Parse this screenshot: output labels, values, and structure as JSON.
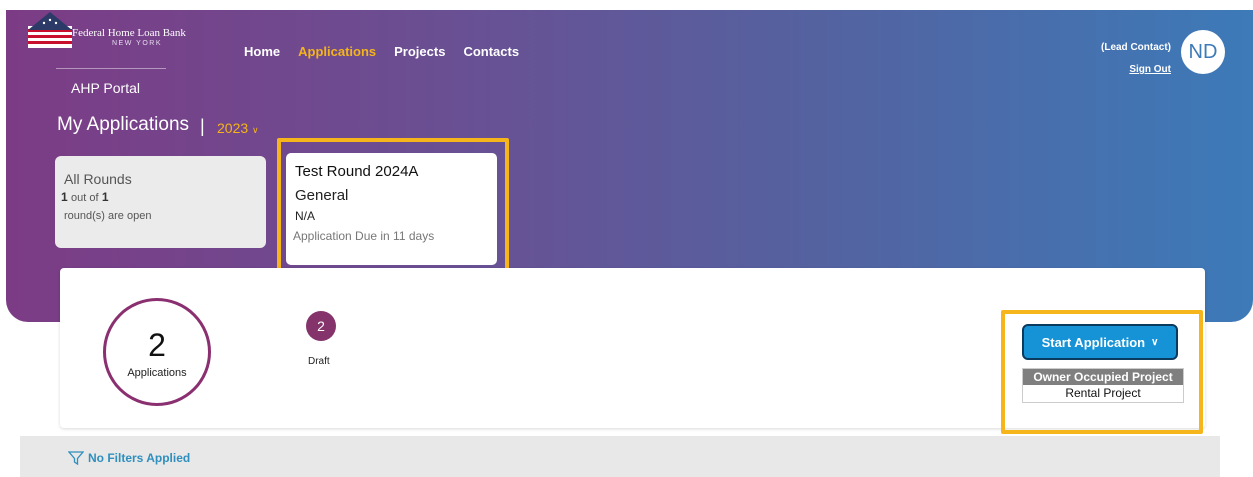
{
  "header": {
    "logo_line1": "Federal Home Loan Bank",
    "logo_line2": "NEW YORK",
    "portal": "AHP Portal",
    "nav": [
      "Home",
      "Applications",
      "Projects",
      "Contacts"
    ],
    "active_nav": "Applications",
    "lead_contact": "(Lead Contact)",
    "sign_out": "Sign Out",
    "avatar_initials": "ND"
  },
  "page": {
    "title": "My Applications",
    "separator": "|",
    "year": "2023"
  },
  "rounds_card": {
    "title": "All Rounds",
    "open_count": "1",
    "out_of": "out of",
    "total": "1",
    "suffix": "round(s) are open"
  },
  "selected_round": {
    "name": "Test Round 2024A",
    "type": "General",
    "detail": "N/A",
    "due": "Application Due in 11 days"
  },
  "summary": {
    "total": "2",
    "total_label": "Applications",
    "draft_count": "2",
    "draft_label": "Draft"
  },
  "actions": {
    "start_label": "Start Application",
    "options": [
      "Owner Occupied Project",
      "Rental Project"
    ],
    "selected_option": "Owner Occupied Project"
  },
  "filters": {
    "label": "No Filters Applied"
  },
  "colors": {
    "accent": "#f4b41a",
    "highlight": "#f7b51c",
    "purple": "#85336b",
    "blue_button": "#1593d6"
  }
}
